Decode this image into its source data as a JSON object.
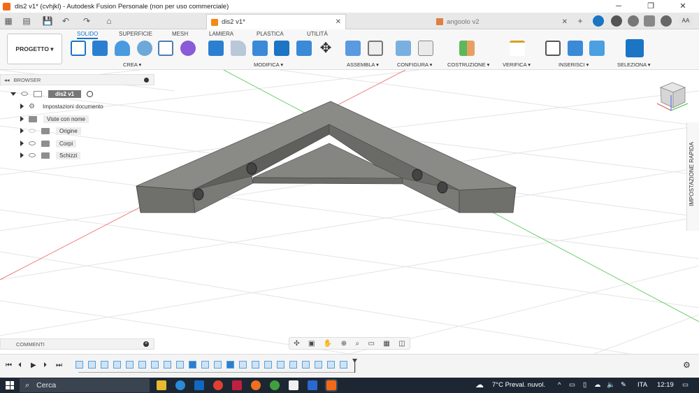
{
  "window": {
    "title": "dis2 v1* (cvhjkl) - Autodesk Fusion Personale (non per uso commerciale)",
    "controls": [
      "─",
      "❐",
      "✕"
    ]
  },
  "tabs": [
    {
      "label": "dis2 v1*",
      "active": true
    },
    {
      "label": "angoolo v2",
      "active": false
    }
  ],
  "ribbon": {
    "project_button": "PROGETTO ▾",
    "tabs": [
      "SOLIDO",
      "SUPERFICIE",
      "MESH",
      "LAMIERA",
      "PLASTICA",
      "UTILITÀ"
    ],
    "active_tab": "SOLIDO",
    "groups": [
      "CREA ▾",
      "MODIFICA ▾",
      "ASSEMBLA ▾",
      "CONFIGURA ▾",
      "COSTRUZIONE ▾",
      "VERIFICA ▾",
      "INSERISCI ▾",
      "SELEZIONA ▾"
    ]
  },
  "browser": {
    "title": "BROWSER",
    "items": [
      {
        "label": "dis2 v1"
      },
      {
        "label": "Impostazioni documento"
      },
      {
        "label": "Viste con nome"
      },
      {
        "label": "Origine"
      },
      {
        "label": "Corpi"
      },
      {
        "label": "Schizzi"
      }
    ]
  },
  "user": {
    "initials": "AA"
  },
  "side_panel": {
    "label": "IMPOSTAZIONE RAPIDA"
  },
  "comments": {
    "label": "COMMENTI"
  },
  "taskbar": {
    "search_placeholder": "Cerca",
    "weather": "7°C Preval. nuvol.",
    "language": "ITA",
    "time": "12:19"
  },
  "colors": {
    "accent": "#1b74c4",
    "model_top": "#8a8a86",
    "model_side": "#6f6f6b",
    "taskbar": "#1d2733",
    "x_axis": "#e05050",
    "y_axis": "#40c040"
  }
}
